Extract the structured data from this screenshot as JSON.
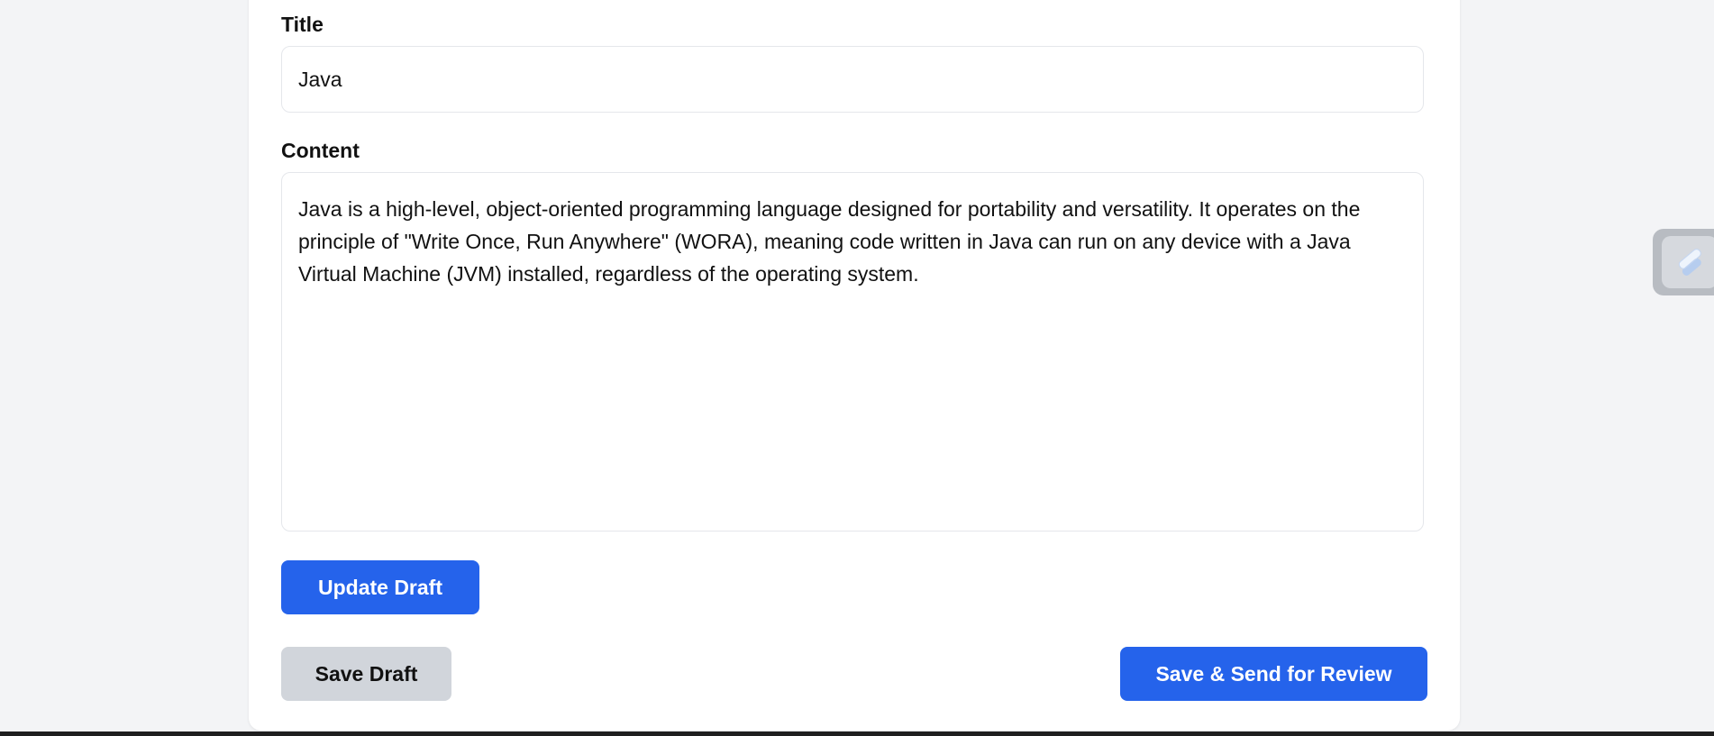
{
  "form": {
    "title_label": "Title",
    "title_value": "Java",
    "content_label": "Content",
    "content_value": "Java is a high-level, object-oriented programming language designed for portability and versatility. It operates on the principle of \"Write Once, Run Anywhere\" (WORA), meaning code written in Java can run on any device with a Java Virtual Machine (JVM) installed, regardless of the operating system."
  },
  "buttons": {
    "update_draft": "Update Draft",
    "save_draft": "Save Draft",
    "save_send_review": "Save & Send for Review"
  },
  "side_widget": {
    "icon": "extension-icon"
  },
  "colors": {
    "primary": "#2563eb",
    "secondary": "#d1d5db",
    "background": "#f3f4f6"
  }
}
